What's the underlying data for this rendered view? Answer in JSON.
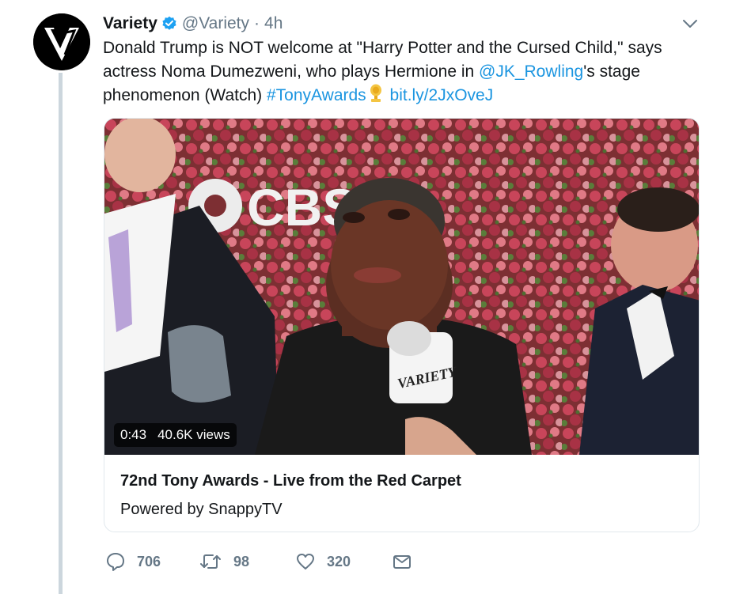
{
  "author": {
    "name": "Variety",
    "handle": "@Variety",
    "separator": "·",
    "time": "4h"
  },
  "tweet": {
    "text_1": "Donald Trump is NOT welcome at \"Harry Potter and the Cursed Child,\" says actress Noma Dumezweni, who plays Hermione in ",
    "mention": "@JK_Rowling",
    "text_2": "'s stage phenomenon (Watch) ",
    "hashtag": "#TonyAwards",
    "url": "bit.ly/2JxOveJ"
  },
  "video": {
    "duration": "0:43",
    "views": "40.6K views",
    "backdrop_text": "CBS",
    "mic_text": "VARIETY"
  },
  "card": {
    "title": "72nd Tony Awards - Live from the Red Carpet",
    "subtitle": "Powered by SnappyTV"
  },
  "actions": {
    "replies": "706",
    "retweets": "98",
    "likes": "320"
  },
  "colors": {
    "link": "#1b95e0",
    "text": "#14171a",
    "muted": "#657786",
    "thread": "#ccd6dd",
    "verified": "#1da1f2"
  },
  "icons": [
    "verified-badge-icon",
    "chevron-down-icon",
    "trophy-emoji-icon",
    "reply-icon",
    "retweet-icon",
    "like-icon",
    "message-icon"
  ]
}
